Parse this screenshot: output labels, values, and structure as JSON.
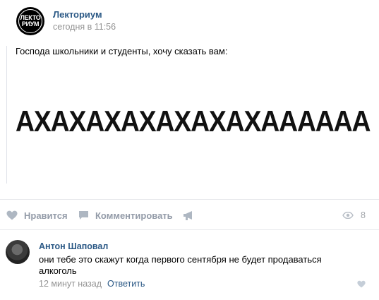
{
  "post": {
    "author": "Лекториум",
    "time": "сегодня в 11:56",
    "avatar_text_line1": "ЛЕКТО",
    "avatar_text_line2": "РИУМ",
    "text": "Господа школьники и студенты, хочу сказать вам:",
    "image_text": "АХАХАХАХАХАХАХАААААА"
  },
  "actions": {
    "like_label": "Нравится",
    "comment_label": "Комментировать",
    "views_count": "8",
    "icon_color": "#939ba8"
  },
  "comment": {
    "author": "Антон Шаповал",
    "text": "они тебе это скажут когда первого сентября не будет продаваться алкоголь",
    "time": "12 минут назад",
    "reply_label": "Ответить"
  },
  "colors": {
    "link": "#2a5885",
    "muted": "#939393",
    "divider": "#e7e8ec"
  }
}
